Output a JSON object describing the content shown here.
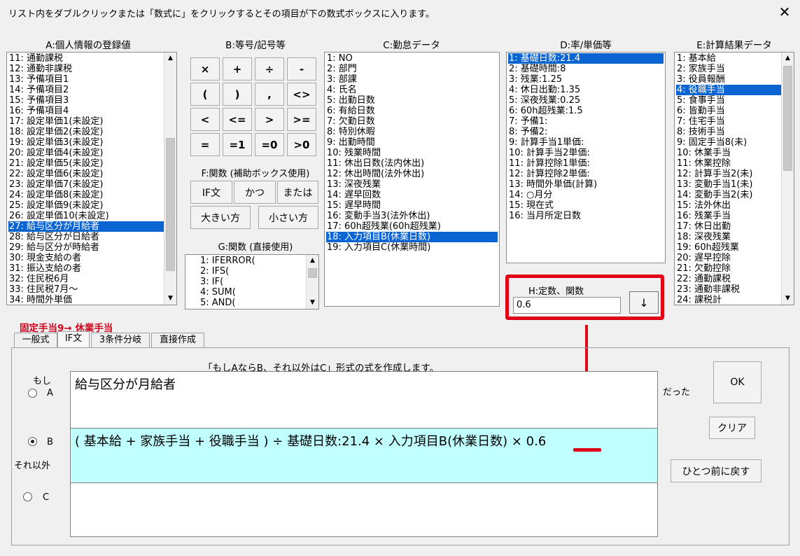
{
  "window": {
    "title": "リスト内をダブルクリックまたは「数式に」をクリックするとその項目が下の数式ボックスに入ります。",
    "close": "✕"
  },
  "listA": {
    "label": "A:個人情報の登録値",
    "items": [
      "11: 通勤課税",
      "12: 通勤非課税",
      "13: 予備項目1",
      "14: 予備項目2",
      "15: 予備項目3",
      "16: 予備項目4",
      "17: 設定単価1(未設定)",
      "18: 設定単価2(未設定)",
      "19: 設定単価3(未設定)",
      "20: 設定単価4(未設定)",
      "21: 設定単価5(未設定)",
      "22: 設定単価6(未設定)",
      "23: 設定単価7(未設定)",
      "24: 設定単価8(未設定)",
      "25: 設定単価9(未設定)",
      "26: 設定単価10(未設定)",
      "27: 給与区分が月給者",
      "28: 給与区分が日給者",
      "29: 給与区分が時給者",
      "30: 現金支給の者",
      "31: 振込支給の者",
      "32: 住民税6月",
      "33: 住民税7月～",
      "34: 時間外単価"
    ]
  },
  "symbols": {
    "label": "B:等号/記号等",
    "buttons": [
      "×",
      "+",
      "÷",
      "-",
      "(",
      ")",
      ",",
      "<>",
      "<",
      "<=",
      ">",
      ">=",
      "=",
      "=1",
      "=0",
      ">0"
    ]
  },
  "functionsF": {
    "label": "F:関数 (補助ボックス使用)",
    "if_label": "IF文",
    "and_label": "かつ",
    "or_label": "または",
    "max_label": "大きい方",
    "min_label": "小さい方"
  },
  "listG": {
    "label": "G:関数 (直接使用)",
    "items": [
      "1: IFERROR(",
      "2: IFS(",
      "3: IF(",
      "4: SUM(",
      "5: AND("
    ]
  },
  "listC": {
    "label": "C:勤怠データ",
    "items": [
      "1: NO",
      "2: 部門",
      "3: 部課",
      "4: 氏名",
      "5: 出勤日数",
      "6: 有給日数",
      "7: 欠勤日数",
      "8: 特別休暇",
      "9: 出勤時間",
      "10: 残業時間",
      "11: 休出日数(法内休出)",
      "12: 休出時間(法外休出)",
      "13: 深夜残業",
      "14: 遅早回数",
      "15: 遅早時間",
      "16: 変動手当3(法外休出)",
      "17: 60h超残業(60h超残業)",
      "18: 入力項目B(休業日数)",
      "19: 入力項目C(休業時間)"
    ]
  },
  "listD": {
    "label": "D:率/単価等",
    "items": [
      "1: 基礎日数:21.4",
      "2: 基礎時間:8",
      "3: 残業:1.25",
      "4: 休日出勤:1.35",
      "5: 深夜残業:0.25",
      "6: 60h超残業:1.5",
      "7: 予備1:",
      "8: 予備2:",
      "9: 計算手当1単価:",
      "10: 計算手当2単価:",
      "11: 計算控除1単価:",
      "12: 計算控除2単価:",
      "13: 時間外単価(計算)",
      "14: ○月分",
      "15: 現在式",
      "16: 当月所定日数"
    ]
  },
  "listE": {
    "label": "E:計算結果データ",
    "items": [
      "1: 基本給",
      "2: 家族手当",
      "3: 役員報酬",
      "4: 役職手当",
      "5: 食事手当",
      "6: 皆勤手当",
      "7: 住宅手当",
      "8: 技術手当",
      "9: 固定手当8(未)",
      "10: 休業手当",
      "11: 休業控除",
      "12: 計算手当2(未)",
      "13: 変動手当1(未)",
      "14: 変動手当2(未)",
      "15: 法外休出",
      "16: 残業手当",
      "17: 休日出勤",
      "18: 深夜残業",
      "19: 60h超残業",
      "20: 遅早控除",
      "21: 欠勤控除",
      "22: 通勤課税",
      "23: 通勤非課税",
      "24: 課税計"
    ]
  },
  "constantH": {
    "label": "H:定数、関数",
    "value": "0.6",
    "arrow_label": "↓"
  },
  "target_title": "固定手当9→ 休業手当",
  "tabs": [
    "一般式",
    "IF文",
    "3条件分岐",
    "直接作成"
  ],
  "if_panel": {
    "description": "「もしAならB、それ以外はC」形式の式を作成します。",
    "moshi": "もし",
    "option_a": "A",
    "option_b": "B",
    "option_c": "C",
    "sorei": "それ以外",
    "datta": "だった",
    "formula_a": "給与区分が月給者",
    "formula_b_main": "( 基本給 + 家族手当 + 役職手当 ) ÷ 基礎日数:21.4 × 入力項目B(休業日数) × ",
    "formula_b_tail": "0.6",
    "formula_c": ""
  },
  "actions": {
    "ok": "OK",
    "clear": "クリア",
    "undo": "ひとつ前に戻す"
  },
  "colors": {
    "selection": "#0a64d2",
    "highlight_red": "#e00018",
    "formula_b_bg": "#c0ffff",
    "title_red": "#d0021b"
  },
  "selected": {
    "listA": 16,
    "listC": 17,
    "listD": 0,
    "listE": 3,
    "radio": "B"
  }
}
